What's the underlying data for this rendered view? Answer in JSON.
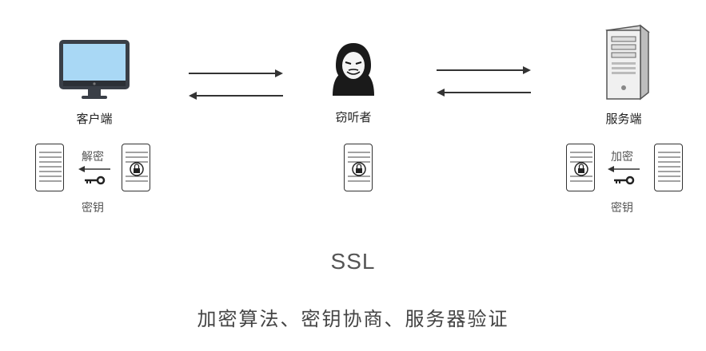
{
  "nodes": {
    "client": {
      "label": "客户端"
    },
    "eavesdropper": {
      "label": "窃听者"
    },
    "server": {
      "label": "服务端"
    }
  },
  "client_side": {
    "action": "解密",
    "key": "密钥"
  },
  "server_side": {
    "action": "加密",
    "key": "密钥"
  },
  "title": "SSL",
  "subtitle": "加密算法、密钥协商、服务器验证",
  "colors": {
    "screen": "#a9d8f5",
    "line": "#333333",
    "server_body": "#f0f0f0"
  }
}
